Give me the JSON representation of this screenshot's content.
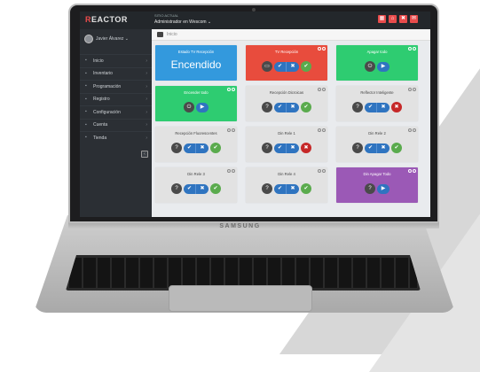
{
  "brand": {
    "laptop": "SAMSUNG"
  },
  "app": {
    "logo_prefix": "R",
    "logo_rest": "EACTOR",
    "site_label": "Sitio actual",
    "site_value": "Administrador en Wescom ⌄",
    "user": "Javier Álvarez ⌄",
    "breadcrumb": "Inicio"
  },
  "menu": [
    {
      "label": "Inicio"
    },
    {
      "label": "Inventario"
    },
    {
      "label": "Programación"
    },
    {
      "label": "Registro"
    },
    {
      "label": "Configuración"
    },
    {
      "label": "Cuenta"
    },
    {
      "label": "Tienda"
    }
  ],
  "cards": [
    {
      "title": "Estado TV Recepción",
      "big": "Encendido",
      "color": "#3399dd"
    },
    {
      "title": "TV Recepción",
      "color": "#e84c3d"
    },
    {
      "title": "Apagar todo",
      "color": "#2ecc71"
    },
    {
      "title": "Encender todo",
      "color": "#2ecc71"
    },
    {
      "title": "Recepción Dicroicas",
      "color": "#e2e2e2"
    },
    {
      "title": "Reflector Inteligente",
      "color": "#e2e2e2"
    },
    {
      "title": "Recepción Fluorescentes",
      "color": "#e2e2e2"
    },
    {
      "title": "Din Rele 1",
      "color": "#e2e2e2"
    },
    {
      "title": "Din Rele 2",
      "color": "#e2e2e2"
    },
    {
      "title": "Din Rele 3",
      "color": "#e2e2e2"
    },
    {
      "title": "Din Rele 4",
      "color": "#e2e2e2"
    },
    {
      "title": "Din Apagar Todo",
      "color": "#9b59b6"
    }
  ],
  "icons": {
    "status": "?",
    "power": "⏻",
    "check": "✔",
    "cross": "✖",
    "play": "▶"
  }
}
